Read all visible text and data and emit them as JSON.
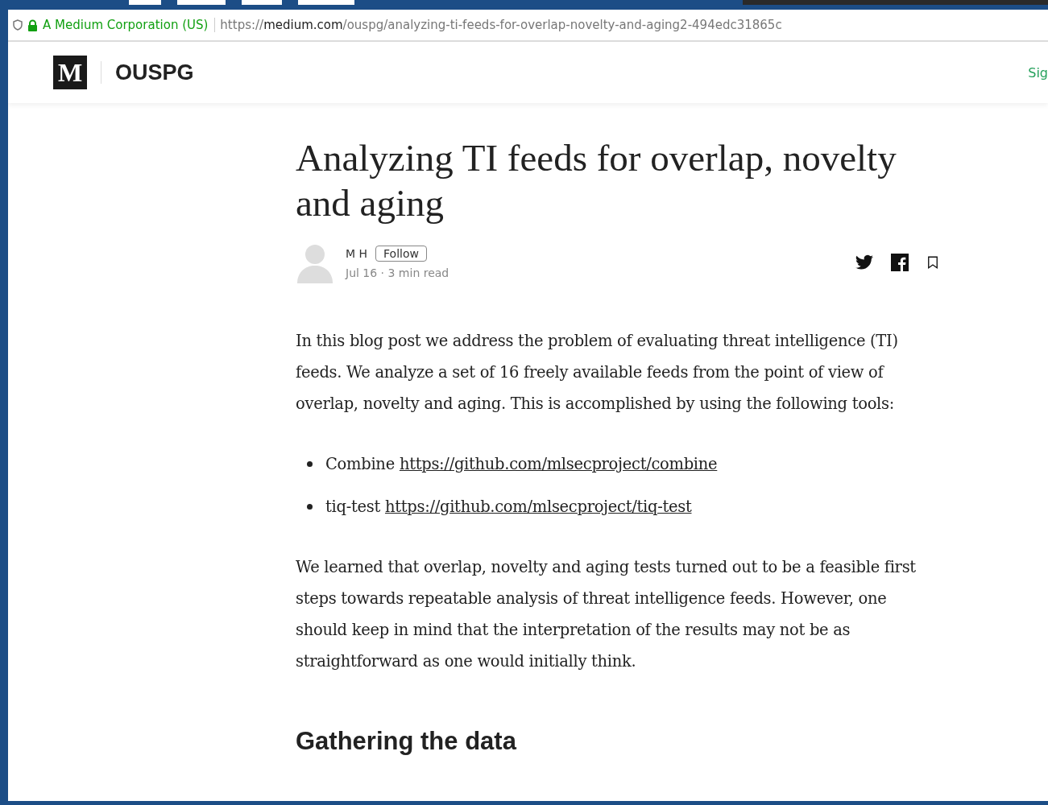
{
  "browser": {
    "site_identity": "A Medium Corporation (US)",
    "url": "https://**medium.com**/ouspg/analyzing-ti-feeds-for-overlap-novelty-and-aging2-494edc31865c"
  },
  "header": {
    "logo": "M",
    "publication": "OUSPG",
    "sign_in": "Sig"
  },
  "article": {
    "title": "Analyzing TI feeds for overlap, novelty and aging",
    "author": {
      "name": "M H",
      "follow": "Follow",
      "date": "Jul 16",
      "separator": "·",
      "read_time": "3 min read"
    },
    "paragraphs": [
      "In this blog post we address the problem of evaluating threat intelligence (TI) feeds. We analyze a set of 16 freely available feeds from the point of view of overlap, novelty and aging. This is accomplished by using the following tools:"
    ],
    "tools": [
      {
        "name": "Combine",
        "link": "https://github.com/mlsecproject/combine"
      },
      {
        "name": "tiq-test",
        "link": "https://github.com/mlsecproject/tiq-test"
      }
    ],
    "conclusion": "We learned that overlap, novelty and aging tests turned out to be a feasible first steps towards repeatable analysis of threat intelligence feeds. However, one should keep in mind that the interpretation of the results may not be as straightforward as one would initially think.",
    "section_heading": "Gathering the data"
  }
}
